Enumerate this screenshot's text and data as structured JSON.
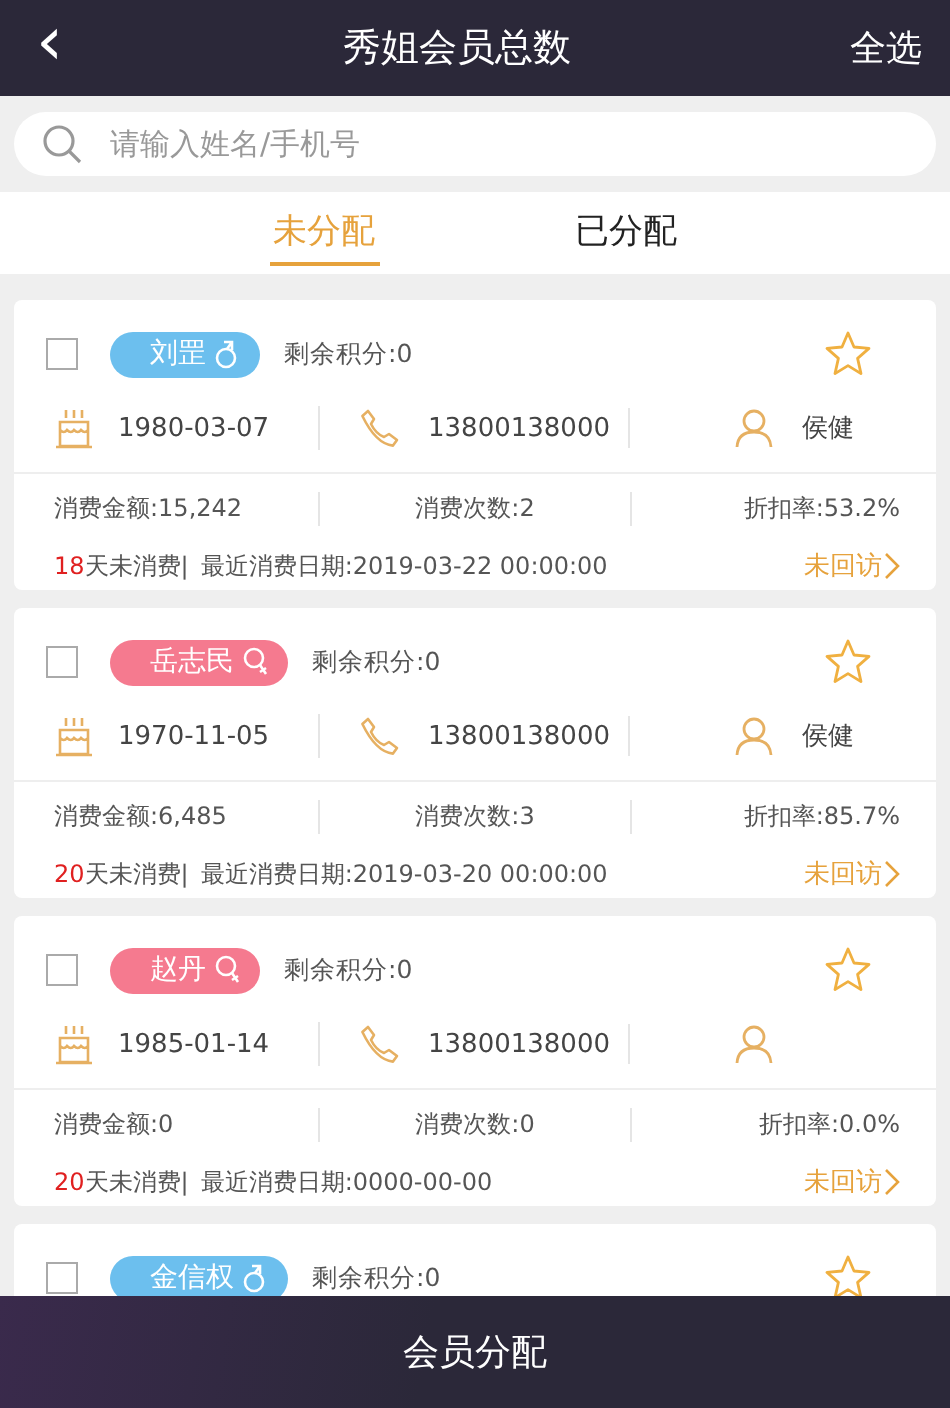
{
  "header": {
    "back": "‹",
    "title": "秀姐会员总数",
    "action": "全选"
  },
  "search": {
    "placeholder": "请输入姓名/手机号"
  },
  "tabs": [
    {
      "label": "未分配",
      "selected": true
    },
    {
      "label": "已分配",
      "selected": false
    }
  ],
  "members": [
    {
      "checked": false,
      "name": "刘罡",
      "kind": "male",
      "points": "剩余积分:0",
      "starred": false,
      "birthday": "1980-03-07",
      "phone": "13800138000",
      "staff": "侯健",
      "amount": "消费金额:15,242",
      "count": "消费次数:2",
      "discount": "折扣率:53.2%",
      "idle_days": "18",
      "idle_suffix": "天未消费|",
      "last_date": "最近消费日期:2019-03-22 00:00:00",
      "visit": "未回访"
    },
    {
      "checked": false,
      "name": "岳志民",
      "kind": "female",
      "points": "剩余积分:0",
      "starred": false,
      "birthday": "1970-11-05",
      "phone": "13800138000",
      "staff": "侯健",
      "amount": "消费金额:6,485",
      "count": "消费次数:3",
      "discount": "折扣率:85.7%",
      "idle_days": "20",
      "idle_suffix": "天未消费|",
      "last_date": "最近消费日期:2019-03-20 00:00:00",
      "visit": "未回访"
    },
    {
      "checked": false,
      "name": "赵丹",
      "kind": "female",
      "points": "剩余积分:0",
      "starred": false,
      "birthday": "1985-01-14",
      "phone": "13800138000",
      "amount": "消费金额:0",
      "count": "消费次数:0",
      "discount": "折扣率:0.0%",
      "idle_days": "20",
      "idle_suffix": "天未消费|",
      "last_date": "最近消费日期:0000-00-00",
      "visit": "未回访"
    },
    {
      "checked": false,
      "name": "金信权",
      "kind": "male",
      "points": "剩余积分:0",
      "starred": false
    }
  ],
  "bottom_button": "会员分配"
}
